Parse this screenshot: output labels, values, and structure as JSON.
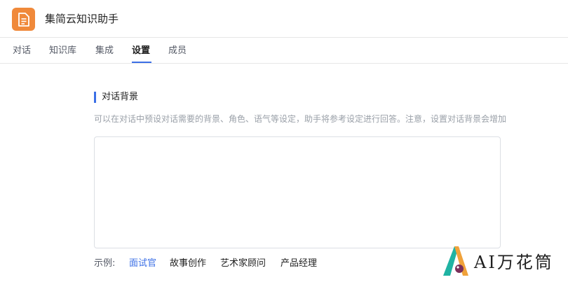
{
  "app": {
    "title": "集简云知识助手",
    "icon": "document-icon",
    "icon_color": "#f0893a"
  },
  "tabs": [
    {
      "label": "对话",
      "active": false
    },
    {
      "label": "知识库",
      "active": false
    },
    {
      "label": "集成",
      "active": false
    },
    {
      "label": "设置",
      "active": true
    },
    {
      "label": "成员",
      "active": false
    }
  ],
  "accent_color": "#3b6fe6",
  "settings": {
    "section_title": "对话背景",
    "section_description": "可以在对话中预设对话需要的背景、角色、语气等设定，助手将参考设定进行回答。注意，设置对话背景会增加",
    "background_value": "",
    "examples_label": "示例:",
    "examples": [
      {
        "label": "面试官",
        "active": true
      },
      {
        "label": "故事创作",
        "active": false
      },
      {
        "label": "艺术家顾问",
        "active": false
      },
      {
        "label": "产品经理",
        "active": false
      }
    ]
  },
  "watermark": {
    "text": "AI万花筒"
  }
}
